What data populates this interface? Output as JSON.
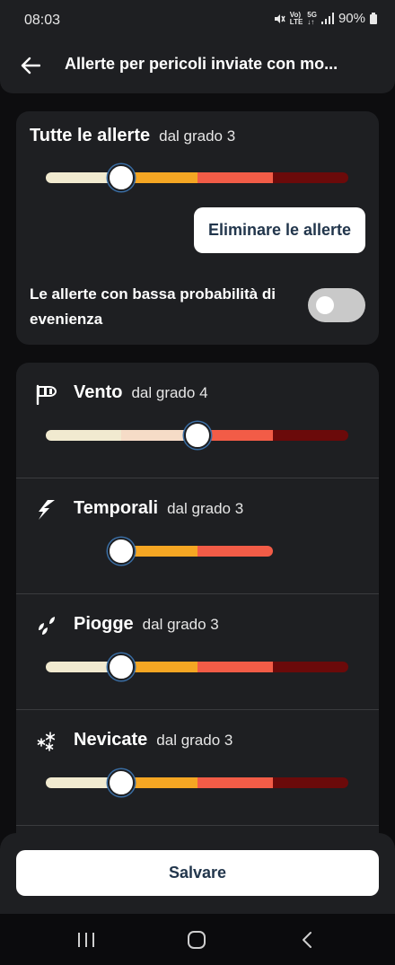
{
  "status_bar": {
    "time": "08:03",
    "battery": "90%",
    "icons": [
      "mute-icon",
      "volte-icon",
      "5g-icon",
      "signal-icon",
      "battery-icon"
    ]
  },
  "app_bar": {
    "title": "Allerte per pericoli inviate con mo...",
    "back_icon": "arrow-left-icon"
  },
  "all_alerts": {
    "label": "Tutte le allerte",
    "grade": "dal grado 3",
    "selected_level": 2,
    "levels": 4,
    "delete_button": "Eliminare le allerte",
    "low_probability_label": "Le allerte con bassa probabilità di evenienza",
    "low_probability_enabled": false
  },
  "categories": [
    {
      "name": "Vento",
      "grade": "dal grado 4",
      "icon": "windsock-icon",
      "selected_level": 3,
      "levels": 4
    },
    {
      "name": "Temporali",
      "grade": "dal grado 3",
      "icon": "lightning-icon",
      "selected_level": 2,
      "levels": 3
    },
    {
      "name": "Piogge",
      "grade": "dal grado 3",
      "icon": "rain-icon",
      "selected_level": 2,
      "levels": 4
    },
    {
      "name": "Nevicate",
      "grade": "dal grado 3",
      "icon": "snowflake-icon",
      "selected_level": 2,
      "levels": 4
    }
  ],
  "save_button": "Salvare",
  "colors": {
    "level_1": "#f1ead0",
    "level_1_active": "#f6dcc7",
    "level_2": "#f5a623",
    "level_3": "#f25c47",
    "level_4": "#6b0a0a",
    "background": "#1e1f22",
    "button_text": "#22364c"
  },
  "nav_bar": [
    "recents-icon",
    "home-icon",
    "back-icon"
  ]
}
